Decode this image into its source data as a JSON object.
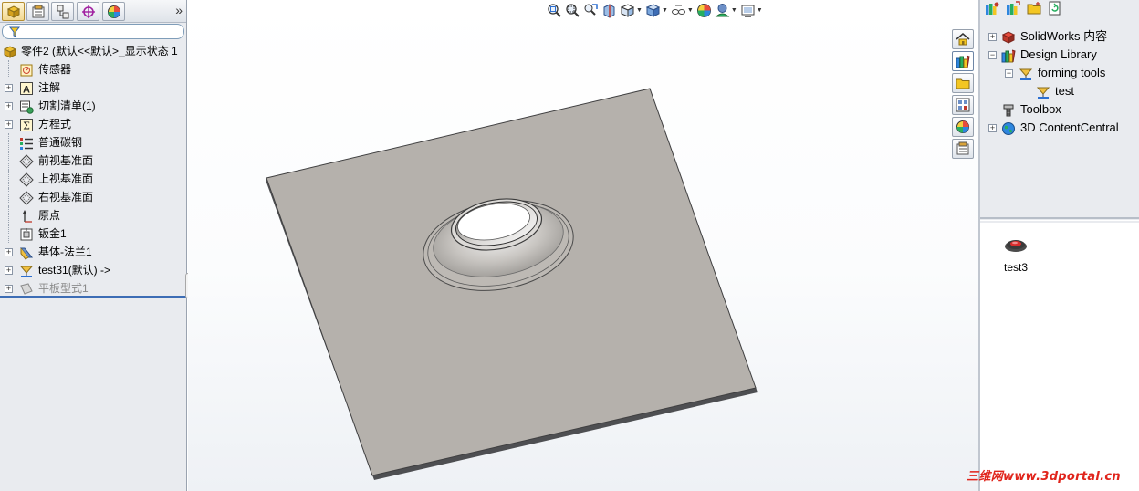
{
  "left_panel": {
    "tabs": [
      {
        "name": "featuremanager",
        "icon": "featuremanager-tree-icon"
      },
      {
        "name": "propertymanager",
        "icon": "propertymanager-icon"
      },
      {
        "name": "configurationmanager",
        "icon": "configurationmanager-icon"
      },
      {
        "name": "dimxpert",
        "icon": "dimxpert-crosshair-icon"
      },
      {
        "name": "display-manager",
        "icon": "display-manager-color-icon"
      }
    ],
    "more_tabs_label": "»",
    "filter_icon": "filter-icon",
    "tree": [
      {
        "label": "零件2 (默认<<默认>_显示状态 1",
        "icon": "part-icon",
        "expander": "",
        "root": true
      },
      {
        "label": "传感器",
        "icon": "sensor-icon",
        "expander": ""
      },
      {
        "label": "注解",
        "icon": "annotation-icon",
        "expander": "+"
      },
      {
        "label": "切割清单(1)",
        "icon": "cut-list-icon",
        "expander": "+"
      },
      {
        "label": "方程式",
        "icon": "equation-icon",
        "expander": "+"
      },
      {
        "label": "普通碳钢",
        "icon": "material-icon",
        "expander": ""
      },
      {
        "label": "前视基准面",
        "icon": "plane-icon",
        "expander": ""
      },
      {
        "label": "上视基准面",
        "icon": "plane-icon",
        "expander": ""
      },
      {
        "label": "右视基准面",
        "icon": "plane-icon",
        "expander": ""
      },
      {
        "label": "原点",
        "icon": "origin-icon",
        "expander": ""
      },
      {
        "label": "钣金1",
        "icon": "sheet-metal-icon",
        "expander": ""
      },
      {
        "label": "基体-法兰1",
        "icon": "base-flange-icon",
        "expander": "+"
      },
      {
        "label": "test31(默认) ->",
        "icon": "forming-tool-feature-icon",
        "expander": "+"
      },
      {
        "label": "平板型式1",
        "icon": "flat-pattern-icon",
        "expander": "+",
        "suppressed": true
      }
    ]
  },
  "view_toolbar": [
    {
      "name": "zoom-to-fit",
      "icon": "zoom-to-fit-icon"
    },
    {
      "name": "zoom-to-area",
      "icon": "zoom-to-area-icon"
    },
    {
      "name": "previous-view",
      "icon": "previous-view-icon"
    },
    {
      "name": "section-view",
      "icon": "section-view-icon"
    },
    {
      "name": "view-orientation",
      "icon": "view-orientation-icon",
      "dropdown": true
    },
    {
      "name": "display-style",
      "icon": "display-style-cube-icon",
      "dropdown": true
    },
    {
      "name": "hide-show-items",
      "icon": "hide-show-items-icon",
      "dropdown": true
    },
    {
      "name": "edit-appearance",
      "icon": "edit-appearance-icon"
    },
    {
      "name": "apply-scene",
      "icon": "apply-scene-icon",
      "dropdown": true
    },
    {
      "name": "view-settings",
      "icon": "view-settings-icon",
      "dropdown": true
    }
  ],
  "task_pane": {
    "side_tabs": [
      {
        "name": "solidworks-resources",
        "icon": "home-icon"
      },
      {
        "name": "design-library",
        "icon": "design-library-icon",
        "active": true
      },
      {
        "name": "file-explorer",
        "icon": "folder-icon"
      },
      {
        "name": "view-palette",
        "icon": "view-palette-icon"
      },
      {
        "name": "appearances-scenes",
        "icon": "appearances-icon"
      },
      {
        "name": "custom-properties",
        "icon": "custom-properties-icon"
      }
    ],
    "toolbar": [
      {
        "name": "add-to-library",
        "icon": "add-to-library-icon"
      },
      {
        "name": "add-file-location",
        "icon": "add-file-location-icon"
      },
      {
        "name": "create-new-folder",
        "icon": "new-folder-icon"
      },
      {
        "name": "refresh",
        "icon": "refresh-icon"
      }
    ],
    "tree": [
      {
        "label": "SolidWorks 内容",
        "icon": "solidworks-content-icon",
        "expander": "+",
        "level": 0
      },
      {
        "label": "Design Library",
        "icon": "design-library-icon",
        "expander": "−",
        "level": 0
      },
      {
        "label": "forming tools",
        "icon": "forming-tool-icon",
        "expander": "−",
        "level": 1
      },
      {
        "label": "test",
        "icon": "forming-tool-icon",
        "expander": "",
        "level": 2
      },
      {
        "label": "Toolbox",
        "icon": "toolbox-icon",
        "expander": "",
        "level": 0
      },
      {
        "label": "3D ContentCentral",
        "icon": "globe-icon",
        "expander": "+",
        "level": 0
      }
    ],
    "items": [
      {
        "label": "test3",
        "icon": "forming-tool-thumbnail-icon"
      }
    ]
  },
  "watermark": "三维网www.3dportal.cn",
  "colors": {
    "panel_bg": "#e9ebef",
    "plate_top": "#b5b1ac",
    "plate_edge": "#4e4f52",
    "accent_blue": "#3d6db5",
    "watermark": "#e0241b"
  }
}
